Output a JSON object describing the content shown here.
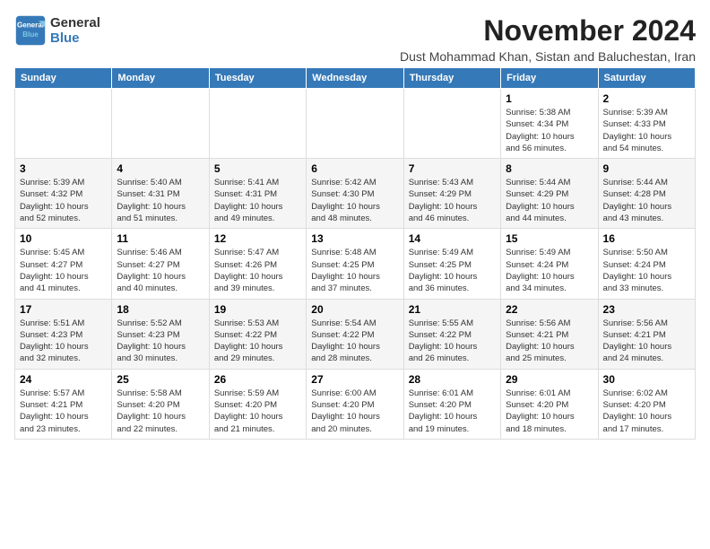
{
  "logo": {
    "line1": "General",
    "line2": "Blue"
  },
  "title": "November 2024",
  "subtitle": "Dust Mohammad Khan, Sistan and Baluchestan, Iran",
  "header": {
    "days": [
      "Sunday",
      "Monday",
      "Tuesday",
      "Wednesday",
      "Thursday",
      "Friday",
      "Saturday"
    ]
  },
  "weeks": [
    [
      {
        "day": "",
        "info": ""
      },
      {
        "day": "",
        "info": ""
      },
      {
        "day": "",
        "info": ""
      },
      {
        "day": "",
        "info": ""
      },
      {
        "day": "",
        "info": ""
      },
      {
        "day": "1",
        "info": "Sunrise: 5:38 AM\nSunset: 4:34 PM\nDaylight: 10 hours\nand 56 minutes."
      },
      {
        "day": "2",
        "info": "Sunrise: 5:39 AM\nSunset: 4:33 PM\nDaylight: 10 hours\nand 54 minutes."
      }
    ],
    [
      {
        "day": "3",
        "info": "Sunrise: 5:39 AM\nSunset: 4:32 PM\nDaylight: 10 hours\nand 52 minutes."
      },
      {
        "day": "4",
        "info": "Sunrise: 5:40 AM\nSunset: 4:31 PM\nDaylight: 10 hours\nand 51 minutes."
      },
      {
        "day": "5",
        "info": "Sunrise: 5:41 AM\nSunset: 4:31 PM\nDaylight: 10 hours\nand 49 minutes."
      },
      {
        "day": "6",
        "info": "Sunrise: 5:42 AM\nSunset: 4:30 PM\nDaylight: 10 hours\nand 48 minutes."
      },
      {
        "day": "7",
        "info": "Sunrise: 5:43 AM\nSunset: 4:29 PM\nDaylight: 10 hours\nand 46 minutes."
      },
      {
        "day": "8",
        "info": "Sunrise: 5:44 AM\nSunset: 4:29 PM\nDaylight: 10 hours\nand 44 minutes."
      },
      {
        "day": "9",
        "info": "Sunrise: 5:44 AM\nSunset: 4:28 PM\nDaylight: 10 hours\nand 43 minutes."
      }
    ],
    [
      {
        "day": "10",
        "info": "Sunrise: 5:45 AM\nSunset: 4:27 PM\nDaylight: 10 hours\nand 41 minutes."
      },
      {
        "day": "11",
        "info": "Sunrise: 5:46 AM\nSunset: 4:27 PM\nDaylight: 10 hours\nand 40 minutes."
      },
      {
        "day": "12",
        "info": "Sunrise: 5:47 AM\nSunset: 4:26 PM\nDaylight: 10 hours\nand 39 minutes."
      },
      {
        "day": "13",
        "info": "Sunrise: 5:48 AM\nSunset: 4:25 PM\nDaylight: 10 hours\nand 37 minutes."
      },
      {
        "day": "14",
        "info": "Sunrise: 5:49 AM\nSunset: 4:25 PM\nDaylight: 10 hours\nand 36 minutes."
      },
      {
        "day": "15",
        "info": "Sunrise: 5:49 AM\nSunset: 4:24 PM\nDaylight: 10 hours\nand 34 minutes."
      },
      {
        "day": "16",
        "info": "Sunrise: 5:50 AM\nSunset: 4:24 PM\nDaylight: 10 hours\nand 33 minutes."
      }
    ],
    [
      {
        "day": "17",
        "info": "Sunrise: 5:51 AM\nSunset: 4:23 PM\nDaylight: 10 hours\nand 32 minutes."
      },
      {
        "day": "18",
        "info": "Sunrise: 5:52 AM\nSunset: 4:23 PM\nDaylight: 10 hours\nand 30 minutes."
      },
      {
        "day": "19",
        "info": "Sunrise: 5:53 AM\nSunset: 4:22 PM\nDaylight: 10 hours\nand 29 minutes."
      },
      {
        "day": "20",
        "info": "Sunrise: 5:54 AM\nSunset: 4:22 PM\nDaylight: 10 hours\nand 28 minutes."
      },
      {
        "day": "21",
        "info": "Sunrise: 5:55 AM\nSunset: 4:22 PM\nDaylight: 10 hours\nand 26 minutes."
      },
      {
        "day": "22",
        "info": "Sunrise: 5:56 AM\nSunset: 4:21 PM\nDaylight: 10 hours\nand 25 minutes."
      },
      {
        "day": "23",
        "info": "Sunrise: 5:56 AM\nSunset: 4:21 PM\nDaylight: 10 hours\nand 24 minutes."
      }
    ],
    [
      {
        "day": "24",
        "info": "Sunrise: 5:57 AM\nSunset: 4:21 PM\nDaylight: 10 hours\nand 23 minutes."
      },
      {
        "day": "25",
        "info": "Sunrise: 5:58 AM\nSunset: 4:20 PM\nDaylight: 10 hours\nand 22 minutes."
      },
      {
        "day": "26",
        "info": "Sunrise: 5:59 AM\nSunset: 4:20 PM\nDaylight: 10 hours\nand 21 minutes."
      },
      {
        "day": "27",
        "info": "Sunrise: 6:00 AM\nSunset: 4:20 PM\nDaylight: 10 hours\nand 20 minutes."
      },
      {
        "day": "28",
        "info": "Sunrise: 6:01 AM\nSunset: 4:20 PM\nDaylight: 10 hours\nand 19 minutes."
      },
      {
        "day": "29",
        "info": "Sunrise: 6:01 AM\nSunset: 4:20 PM\nDaylight: 10 hours\nand 18 minutes."
      },
      {
        "day": "30",
        "info": "Sunrise: 6:02 AM\nSunset: 4:20 PM\nDaylight: 10 hours\nand 17 minutes."
      }
    ]
  ]
}
